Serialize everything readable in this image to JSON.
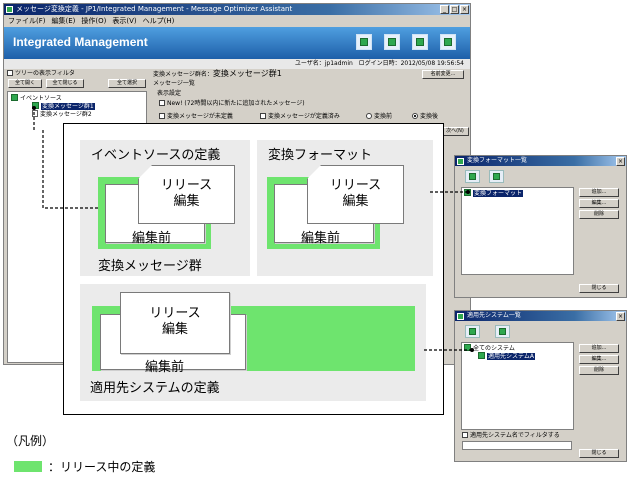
{
  "main_window": {
    "title": "メッセージ変換定義 - JP1/Integrated Management - Message Optimizer Assistant",
    "menu": [
      "ファイル(F)",
      "編集(E)",
      "操作(O)",
      "表示(V)",
      "ヘルプ(H)"
    ],
    "banner": "Integrated Management",
    "user_label": "ユーザ名：jp1admin",
    "login_label": "ログイン日時：2012/05/08 19:56:54",
    "tree_filter_label": "ツリーの表示フィルタ",
    "buttons": {
      "expand_all": "全て開く",
      "collapse_all": "全て閉じる",
      "select_all": "全て選択"
    },
    "tree": {
      "root": "イベントソース",
      "item1": "変換メッセージ群1",
      "item2": "変換メッセージ群2"
    },
    "group_name_label": "変換メッセージ群名：",
    "group_name_value": "変換メッセージ群1",
    "rename_button": "名前変更...",
    "message_list_label": "メッセージ一覧",
    "display_settings_label": "表示設定",
    "new_checkbox": "New! (72時間以内に新たに追加されたメッセージ)",
    "undefined_checkbox": "変換メッセージが未定義",
    "defined_checkbox": "変換メッセージが定義済み",
    "radio_before": "変換前",
    "radio_after": "変換後",
    "next_button": "次へ(N)"
  },
  "format_dialog": {
    "title": "変換フォーマット一覧",
    "item": "変換フォーマット",
    "buttons": [
      "追加...",
      "編集...",
      "削除"
    ],
    "close_button": "閉じる"
  },
  "system_dialog": {
    "title": "適用先システム一覧",
    "tree_root": "全てのシステム",
    "tree_item": "適用先システムA",
    "buttons": [
      "追加...",
      "編集...",
      "削除"
    ],
    "filter_checkbox": "適用先システム名でフィルタする",
    "close_button": "閉じる"
  },
  "diagram": {
    "event_source": {
      "title": "イベントソースの定義",
      "release_line1": "リリース",
      "release_line2": "編集",
      "before_edit": "編集前",
      "caption": "変換メッセージ群"
    },
    "format": {
      "title": "変換フォーマット",
      "release_line1": "リリース",
      "release_line2": "編集",
      "before_edit": "編集前"
    },
    "system": {
      "release_line1": "リリース",
      "release_line2": "編集",
      "before_edit": "編集前",
      "caption": "適用先システムの定義"
    }
  },
  "legend": {
    "heading": "（凡例）",
    "released_label": "：リリース中の定義",
    "released_color": "#6ee46e"
  }
}
